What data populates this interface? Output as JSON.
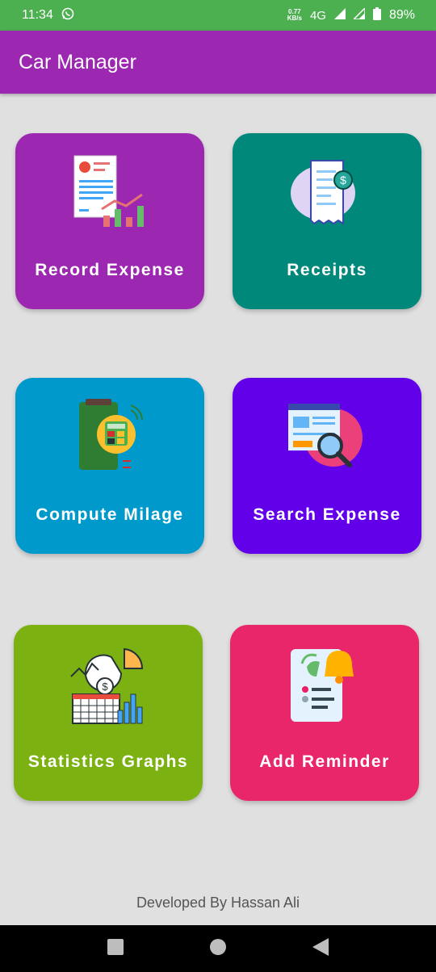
{
  "status_bar": {
    "time": "11:34",
    "net_speed_value": "0.77",
    "net_speed_unit": "KB/s",
    "network_type": "4G",
    "battery": "89%"
  },
  "app_bar": {
    "title": "Car Manager"
  },
  "tiles": [
    {
      "label": "Record Expense",
      "color": "#9c27b0",
      "icon": "expense-report-icon"
    },
    {
      "label": "Receipts",
      "color": "#00897b",
      "icon": "receipt-icon"
    },
    {
      "label": "Compute Milage",
      "color": "#0099cc",
      "icon": "calculator-icon"
    },
    {
      "label": "Search Expense",
      "color": "#6200ea",
      "icon": "search-document-icon"
    },
    {
      "label": "Statistics Graphs",
      "color": "#7cb112",
      "icon": "statistics-chart-icon"
    },
    {
      "label": "Add Reminder",
      "color": "#e9266a",
      "icon": "reminder-bell-icon"
    }
  ],
  "footer": {
    "text": "Developed By Hassan Ali"
  }
}
